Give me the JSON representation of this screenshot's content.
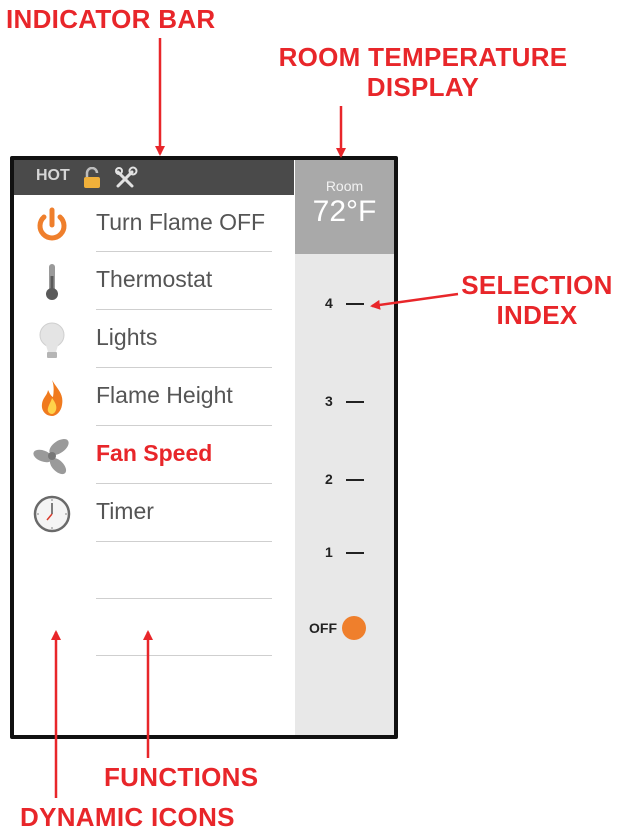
{
  "callouts": {
    "indicator_bar": "INDICATOR BAR",
    "room_temp_line1": "ROOM TEMPERATURE",
    "room_temp_line2": "DISPLAY",
    "selection_line1": "SELECTION",
    "selection_line2": "INDEX",
    "functions": "FUNCTIONS",
    "dynamic_icons": "DYNAMIC ICONS"
  },
  "indicator": {
    "hot": "HOT",
    "icons": [
      "lock-icon",
      "tools-icon"
    ]
  },
  "room": {
    "label": "Room",
    "temperature": "72°F"
  },
  "selection_index": {
    "levels": [
      "4",
      "3",
      "2",
      "1"
    ],
    "off": "OFF",
    "selected": "OFF"
  },
  "menu": {
    "items": [
      {
        "label": "Turn Flame OFF",
        "icon": "power-icon"
      },
      {
        "label": "Thermostat",
        "icon": "thermometer-icon"
      },
      {
        "label": "Lights",
        "icon": "light-bulb-icon"
      },
      {
        "label": "Flame Height",
        "icon": "flame-icon"
      },
      {
        "label": "Fan Speed",
        "icon": "fan-icon",
        "active": true
      },
      {
        "label": "Timer",
        "icon": "clock-icon"
      }
    ]
  },
  "colors": {
    "callout": "#e8262a",
    "accent_orange": "#ef7f2c",
    "indicator_bar": "#4a4a4a",
    "room_box": "#a9a9a9",
    "panel": "#e8e8e8"
  }
}
